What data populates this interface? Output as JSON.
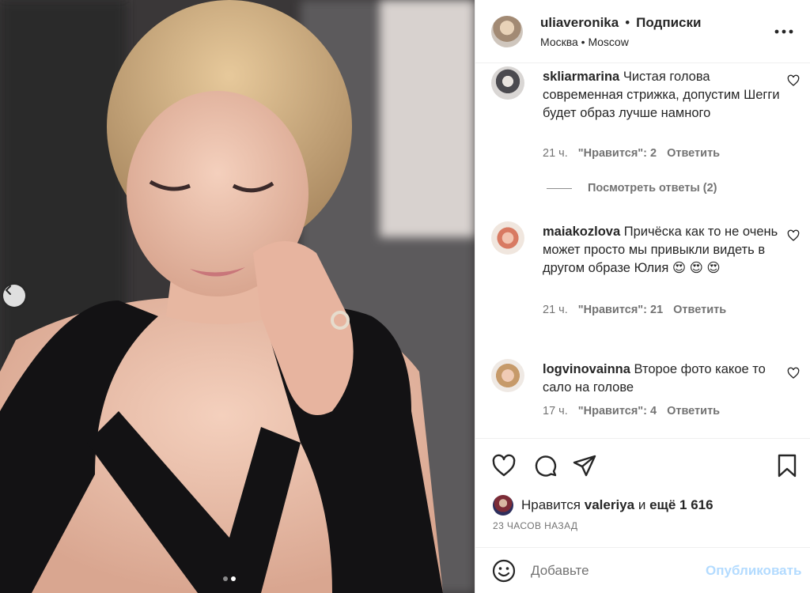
{
  "photo": {
    "icons": {
      "prev": "chevron-left-icon"
    },
    "carousel": {
      "count": 2,
      "active": 1
    }
  },
  "post": {
    "username": "uliaveronika",
    "separator": "•",
    "follow_label": "Подписки",
    "location": "Москва • Moscow",
    "more_icon": "more-horizontal-icon"
  },
  "comments": [
    {
      "username": "skliarmarina",
      "text": "Чистая голова современная стрижка, допустим Шегги будет образ лучше намного",
      "time": "21 ч.",
      "likes": "\"Нравится\": 2",
      "reply": "Ответить"
    },
    {
      "username": "maiakozlova",
      "text": "Причёска как то не очень может просто мы привыкли видеть в другом образе Юлия 😍 😍 😍",
      "time": "21 ч.",
      "likes": "\"Нравится\": 21",
      "reply": "Ответить"
    },
    {
      "username": "logvinovainna",
      "text": "Второе фото какое то сало на голове",
      "time": "17 ч.",
      "likes": "\"Нравится\": 4",
      "reply": "Ответить"
    }
  ],
  "view_replies": "Посмотреть ответы (2)",
  "actions": {
    "icons": [
      "heart-icon",
      "comment-icon",
      "share-icon",
      "bookmark-icon"
    ]
  },
  "likes": {
    "prefix": "Нравится",
    "user": "valeriya",
    "middle": "и",
    "count": "ещё 1 616"
  },
  "timestamp": "23 ЧАСОВ НАЗАД",
  "add_comment": {
    "placeholder": "Добавьте",
    "publish_label": "Опубликовать",
    "emoji_icon": "smiley-icon"
  },
  "colors": {
    "text": "#262626",
    "muted": "#737373",
    "publish_disabled": "#b3dbff",
    "border": "#efefef"
  }
}
